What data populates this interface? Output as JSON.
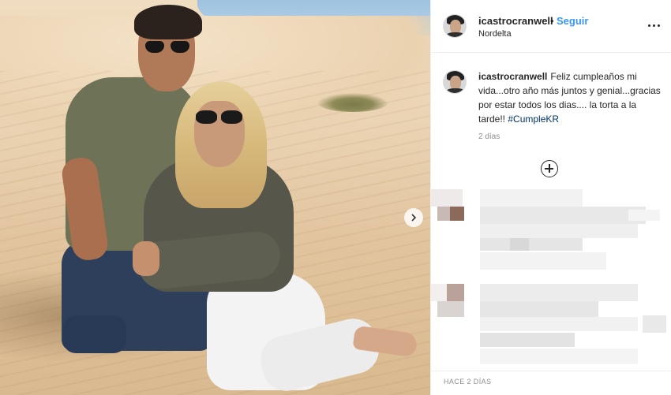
{
  "post": {
    "username": "icastrocranwell",
    "separator": "•",
    "follow_label": "Seguir",
    "location": "Nordelta",
    "more_icon": "more-horizontal-icon",
    "next_icon": "chevron-right-icon",
    "load_more_icon": "plus-circle-icon"
  },
  "caption": {
    "username": "icastrocranwell",
    "text": "Feliz cumpleaños mi vida...otro año más juntos y genial...gracias por estar todos los dias.... la torta a la tarde!! ",
    "hashtag": "#CumpleKR",
    "time": "2 días"
  },
  "comments_state": "pixelated",
  "footer": {
    "time": "HACE 2 DÍAS"
  },
  "colors": {
    "link": "#3897f0",
    "hashtag": "#003569",
    "text": "#262626",
    "muted": "#8e8e8e",
    "border": "#efefef"
  }
}
